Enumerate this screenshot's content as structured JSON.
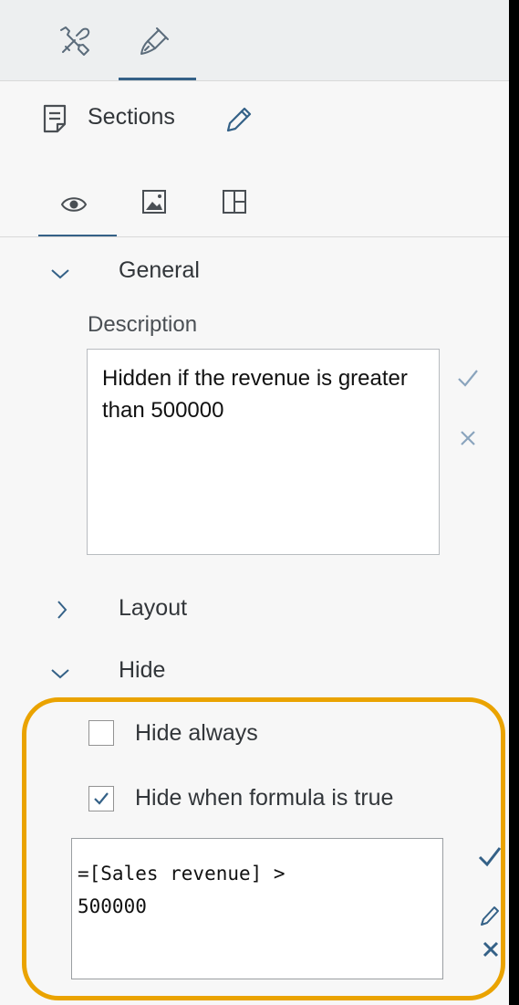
{
  "toolbar": {
    "tabs": [
      {
        "icon": "tools-icon",
        "active": false
      },
      {
        "icon": "paintbrush-icon",
        "active": true
      }
    ]
  },
  "header": {
    "icon": "document-icon",
    "title": "Sections",
    "edit_icon": "pencil-icon"
  },
  "subtabs": [
    {
      "icon": "eye-icon",
      "active": true
    },
    {
      "icon": "image-icon",
      "active": false
    },
    {
      "icon": "layout-grid-icon",
      "active": false
    }
  ],
  "groups": {
    "general": {
      "label": "General",
      "expanded": true,
      "description_label": "Description",
      "description_value": "Hidden if the revenue is greater than 500000"
    },
    "layout": {
      "label": "Layout",
      "expanded": false
    },
    "hide": {
      "label": "Hide",
      "expanded": true,
      "hide_always": {
        "label": "Hide always",
        "checked": false
      },
      "hide_formula": {
        "label": "Hide when formula is true",
        "checked": true
      },
      "formula": "=[Sales revenue] >\n500000"
    }
  },
  "colors": {
    "accent": "#346187",
    "highlight": "#eaa300",
    "confirm": "#346187"
  }
}
